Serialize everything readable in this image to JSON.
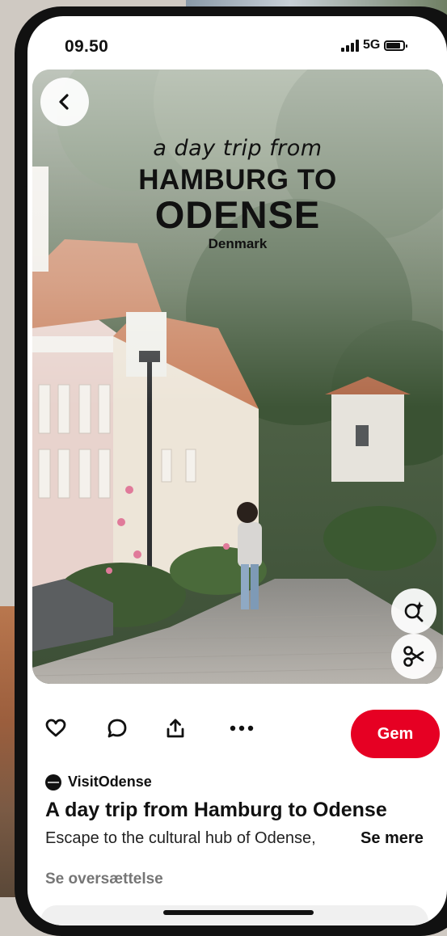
{
  "status_bar": {
    "time": "09.50",
    "network": "5G"
  },
  "pin": {
    "overlay": {
      "line1": "a day trip from",
      "line2": "HAMBURG TO",
      "line3": "ODENSE",
      "line4": "Denmark"
    },
    "image_icon": "photo-of-odense-street",
    "back_icon": "chevron-left-icon",
    "visual_search_icon": "lens-sparkle-icon",
    "cutout_icon": "scissors-icon"
  },
  "actions": {
    "like_icon": "heart-icon",
    "comment_icon": "speech-bubble-icon",
    "share_icon": "share-upload-icon",
    "more_icon": "ellipsis-icon",
    "save_label": "Gem"
  },
  "details": {
    "creator": "VisitOdense",
    "title": "A day trip from Hamburg to Odense",
    "description": "Escape to the cultural hub of Odense,",
    "see_more": "Se mere",
    "translate": "Se oversættelse"
  },
  "colors": {
    "accent": "#e60023",
    "text": "#111111",
    "muted": "#767676"
  }
}
